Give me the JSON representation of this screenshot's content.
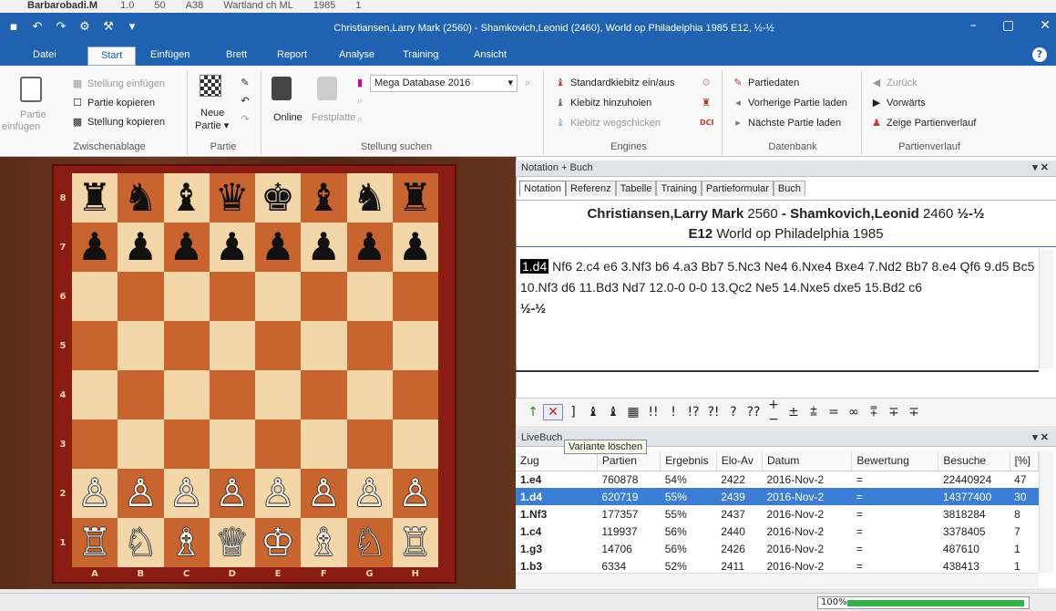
{
  "background_strip": {
    "items": [
      "Barbarobadi.M",
      "1.0",
      "50",
      "A38",
      "Wartland ch ML",
      "1985",
      "1"
    ]
  },
  "window": {
    "title": "Christiansen,Larry Mark (2560) - Shamkovich,Leonid (2460), World op Philadelphia 1985  E12, ½-½"
  },
  "quick_access": [
    "save-icon",
    "undo-icon",
    "redo-icon",
    "gear-icon",
    "tool-icon",
    "dropdown-icon"
  ],
  "menu": {
    "items": [
      "Datei",
      "Start",
      "Einfügen",
      "Brett",
      "Report",
      "Analyse",
      "Training",
      "Ansicht"
    ],
    "active": "Start"
  },
  "ribbon": {
    "zwischenablage": {
      "paste_line1": "Partie",
      "paste_line2": "einfügen",
      "insert_position": "Stellung einfügen",
      "copy_game": "Partie kopieren",
      "copy_position": "Stellung kopieren",
      "group": "Zwischenablage"
    },
    "partie": {
      "new_line1": "Neue",
      "new_line2": "Partie ▾",
      "group": "Partie"
    },
    "stellung": {
      "online": "Online",
      "festplatte": "Festplatte",
      "database": "Mega Database 2016",
      "group": "Stellung suchen"
    },
    "engines": {
      "standard": "Standardkiebitz ein/aus",
      "add": "Kiebitz hinzuholen",
      "remove": "Kiebitz wegschicken",
      "group": "Engines"
    },
    "datenbank": {
      "gamedata": "Partiedaten",
      "prev": "Vorherige Partie laden",
      "next": "Nächste Partie laden",
      "group": "Datenbank"
    },
    "verlauf": {
      "back": "Zurück",
      "forward": "Vorwärts",
      "history": "Zeige Partienverlauf",
      "group": "Partienverlauf"
    }
  },
  "board": {
    "ranks": [
      "8",
      "7",
      "6",
      "5",
      "4",
      "3",
      "2",
      "1"
    ],
    "files": [
      "A",
      "B",
      "C",
      "D",
      "E",
      "F",
      "G",
      "H"
    ],
    "pieces": {
      "r8": [
        "♜",
        "♞",
        "♝",
        "♛",
        "♚",
        "♝",
        "♞",
        "♜"
      ],
      "r7": [
        "♟",
        "♟",
        "♟",
        "♟",
        "♟",
        "♟",
        "♟",
        "♟"
      ],
      "r2": [
        "♙",
        "♙",
        "♙",
        "♙",
        "♙",
        "♙",
        "♙",
        "♙"
      ],
      "r1": [
        "♖",
        "♘",
        "♗",
        "♕",
        "♔",
        "♗",
        "♘",
        "♖"
      ]
    }
  },
  "notation": {
    "header": "Notation + Buch",
    "tabs": [
      "Notation",
      "Referenz",
      "Tabelle",
      "Training",
      "Partieformular",
      "Buch"
    ],
    "white": "Christiansen,Larry Mark",
    "white_elo": "2560",
    "black": "Shamkovich,Leonid",
    "black_elo": "2460",
    "result": "½-½",
    "eco": "E12",
    "event": "World op Philadelphia 1985",
    "current_move": "1.d4",
    "moves_rest": "Nf6 2.c4 e6 3.Nf3 b6 4.a3 Bb7 5.Nc3 Ne4 6.Nxe4 Bxe4 7.Nd2 Bb7 8.e4 Qf6 9.d5 Bc5 10.Nf3 d6 11.Bd3 Nd7 12.0-0 0-0 13.Qc2 Ne5 14.Nxe5 dxe5 15.Bd2 c6",
    "final_result": "½-½"
  },
  "symbols": [
    "↑",
    "✕",
    "]",
    "♝",
    "♝",
    "▦",
    "!!",
    "!",
    "!?",
    "?!",
    "?",
    "??",
    "+−",
    "±",
    "⩲",
    "=",
    "∞",
    "⩱",
    "∓",
    "∓"
  ],
  "livebook": {
    "header": "LiveBuch",
    "tooltip": "Variante löschen",
    "columns": [
      "Zug",
      "Partien",
      "Ergebnis",
      "Elo-Av",
      "Datum",
      "Bewertung",
      "Besuche",
      "[%]"
    ],
    "rows": [
      [
        "1.e4",
        "760878",
        "54%",
        "2422",
        "2016-Nov-2",
        "=",
        "22440924",
        "47"
      ],
      [
        "1.d4",
        "620719",
        "55%",
        "2439",
        "2016-Nov-2",
        "=",
        "14377400",
        "30"
      ],
      [
        "1.Nf3",
        "177357",
        "55%",
        "2437",
        "2016-Nov-2",
        "=",
        "3818284",
        "8"
      ],
      [
        "1.c4",
        "119937",
        "56%",
        "2440",
        "2016-Nov-2",
        "=",
        "3378405",
        "7"
      ],
      [
        "1.g3",
        "14706",
        "56%",
        "2426",
        "2016-Nov-2",
        "=",
        "487610",
        "1"
      ],
      [
        "1.b3",
        "6334",
        "52%",
        "2411",
        "2016-Nov-2",
        "=",
        "438413",
        "1"
      ]
    ],
    "selected_row": 1
  },
  "status": {
    "zoom": "100%",
    "zoom_fraction": 0.85
  }
}
